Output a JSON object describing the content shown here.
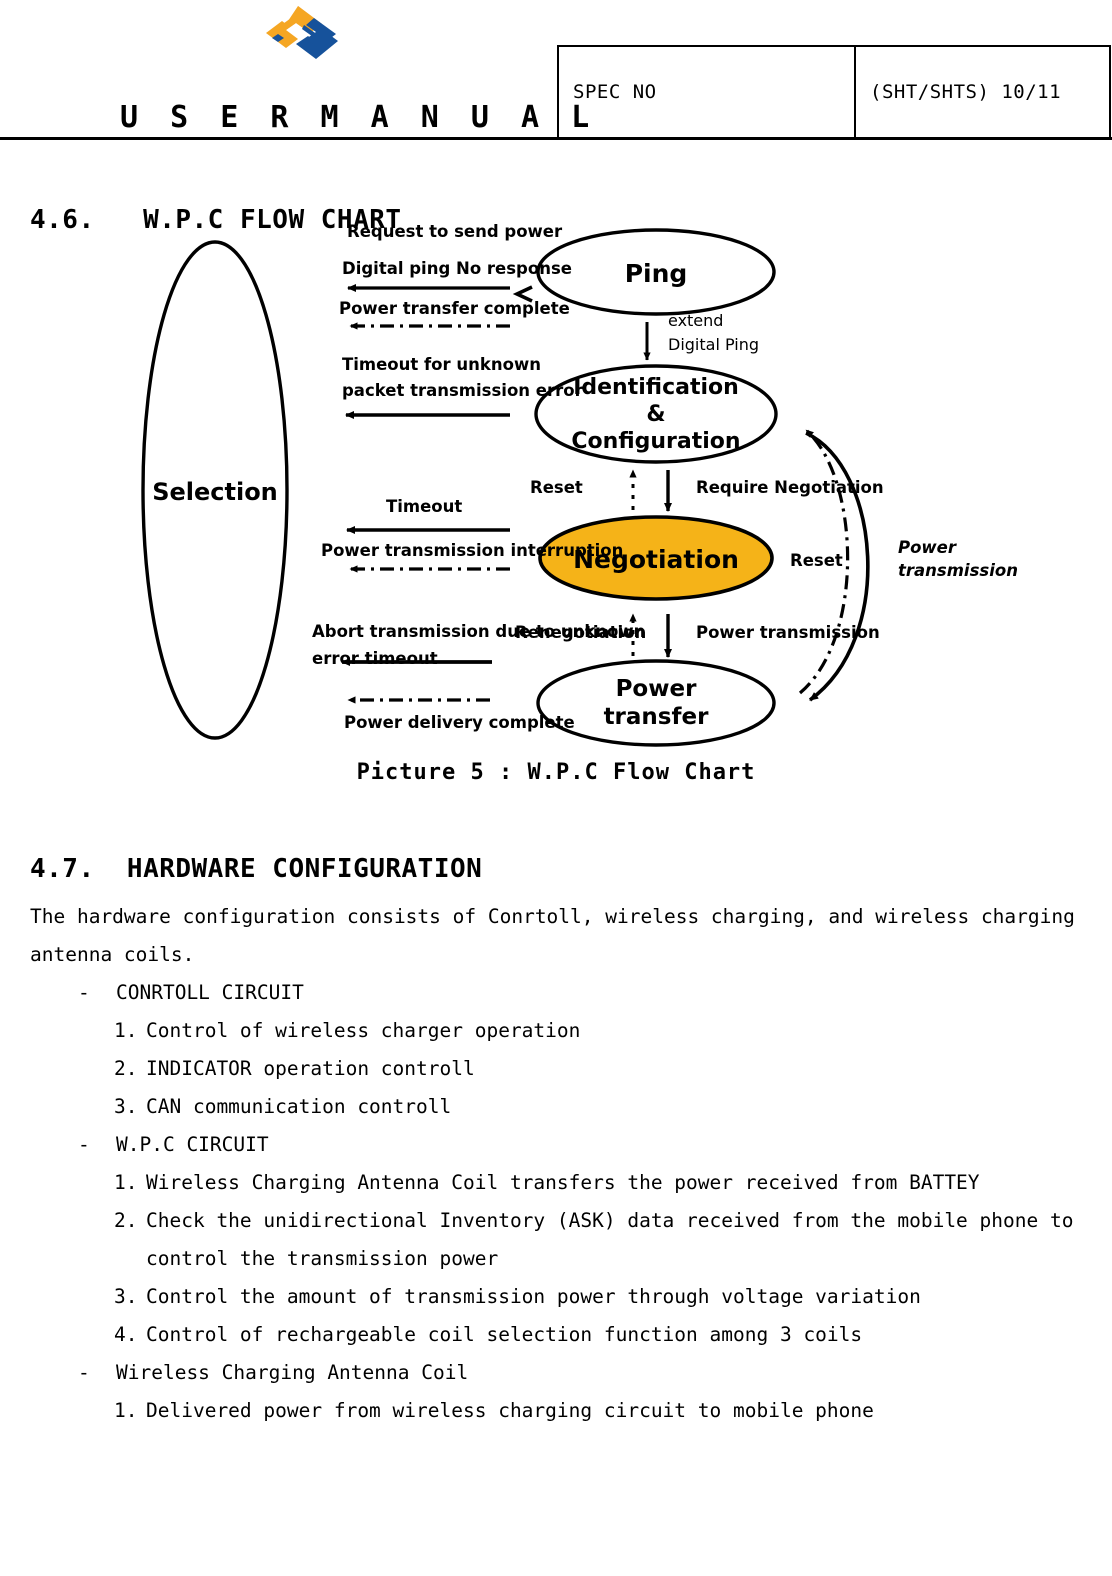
{
  "header": {
    "logo_name": "company-logo",
    "logo_colors": {
      "orange": "#F5A623",
      "blue": "#16529B"
    },
    "manual_title": "U S E R   M A N U A L",
    "spec_no_label": "SPEC NO",
    "spec_no_value": "",
    "sht_label": "(SHT/SHTS)  10/11"
  },
  "sections": {
    "s46_number": "4.6.",
    "s46_title": "W.P.C FLOW CHART",
    "s46_heading": "4.6.   W.P.C FLOW CHART",
    "s47_number": "4.7.",
    "s47_title": "HARDWARE CONFIGURATION",
    "s47_heading": "4.7.  HARDWARE CONFIGURATION"
  },
  "figure": {
    "caption": "Picture 5 : W.P.C Flow Chart",
    "accent_color": "#F5B318",
    "nodes": {
      "selection": "Selection",
      "ping": "Ping",
      "identification_line1": "Identification",
      "identification_line2": "&",
      "identification_line3": "Configuration",
      "negotiation": "Negotiation",
      "power_transfer_line1": "Power",
      "power_transfer_line2": "transfer"
    },
    "labels": {
      "request_to_send_power": "Request to send power",
      "digital_ping_no_response": "Digital ping No response",
      "power_transfer_complete": "Power transfer complete",
      "timeout_unknown_1": "Timeout for unknown",
      "timeout_unknown_2": "packet transmission error",
      "timeout": "Timeout",
      "power_transmission_interruption": "Power transmission interruption",
      "abort_transmission_1": "Abort transmission due to unknown",
      "abort_transmission_2": "error timeout",
      "power_delivery_complete": "Power delivery complete",
      "extend_1": "extend",
      "extend_2": "Digital Ping",
      "reset_left": "Reset",
      "require_negotiation": "Require Negotiation",
      "reset_right": "Reset",
      "renegotiation": "Renegotiation",
      "power_transmission": "Power transmission",
      "power_transmission_right_1": "Power",
      "power_transmission_right_2": "transmission"
    }
  },
  "hardware": {
    "intro_line1": "The hardware configuration consists of Conrtoll, wireless charging, and wireless charging",
    "intro_line2": "antenna coils.",
    "dash": "-",
    "groups": [
      {
        "title": "CONRTOLL CIRCUIT",
        "items": [
          {
            "num": "1.",
            "lines": [
              "Control of wireless charger operation"
            ]
          },
          {
            "num": "2.",
            "lines": [
              "INDICATOR operation controll"
            ]
          },
          {
            "num": "3.",
            "lines": [
              "CAN communication controll"
            ]
          }
        ]
      },
      {
        "title": "W.P.C CIRCUIT",
        "items": [
          {
            "num": "1.",
            "lines": [
              "Wireless Charging Antenna Coil transfers the power received from BATTEY"
            ]
          },
          {
            "num": "2.",
            "lines": [
              "Check the unidirectional Inventory (ASK) data received from the mobile phone to",
              "control the transmission power"
            ]
          },
          {
            "num": "3.",
            "lines": [
              "Control the amount of transmission power through voltage variation"
            ]
          },
          {
            "num": "4.",
            "lines": [
              "Control of rechargeable coil selection function among 3 coils"
            ]
          }
        ]
      },
      {
        "title": "Wireless Charging Antenna Coil",
        "items": [
          {
            "num": "1.",
            "lines": [
              "Delivered power from wireless charging circuit to mobile phone"
            ]
          }
        ]
      }
    ]
  }
}
